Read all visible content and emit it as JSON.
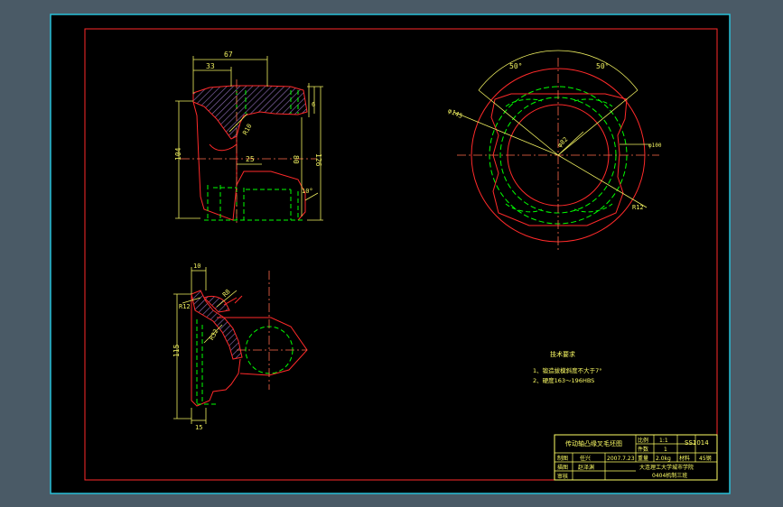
{
  "colors": {
    "window_bg": "#4a5a66",
    "sheet_bg": "#000000",
    "sheet_border": "#27c0d8",
    "outline": "#ff2a2a",
    "hidden": "#00ff00",
    "dimension": "#f0f060",
    "text": "#ffff66",
    "hatch": "#7a5aa0"
  },
  "dims": {
    "d67": "67",
    "d33": "33",
    "d6": "6",
    "r10": "R10",
    "d25": "25",
    "d80": "80",
    "d126": "126",
    "d104": "104",
    "a10": "10°",
    "d10b": "10",
    "r8": "R8",
    "r12b": "R12",
    "r32": "R32",
    "d115": "115",
    "d15": "15",
    "a50l": "50°",
    "a50r": "50°",
    "phi145": "φ145",
    "phi100": "φ100",
    "phi82": "φ82",
    "r12": "R12"
  },
  "notes": {
    "heading": "技术要求",
    "line1": "1、锻造拔模斜度不大于7°",
    "line2": "2、硬度163～196HBS"
  },
  "title_block": {
    "part_name": "传动轴凸缘叉毛坯图",
    "scale_label": "比例",
    "scale_value": "1:1",
    "qty_label": "件数",
    "qty_value": "1",
    "drawing_no": "SS1014",
    "drawn_label": "制图",
    "drawn_by": "任兴",
    "date": "2007.7.23",
    "weight_label": "重量",
    "weight_value": "2.0kg",
    "material_label": "材料",
    "material_value": "45钢",
    "design_label": "描图",
    "design_by": "赵泽渊",
    "school": "大连理工大学城市学院",
    "class": "0404机制三班",
    "review_label": "审核"
  }
}
